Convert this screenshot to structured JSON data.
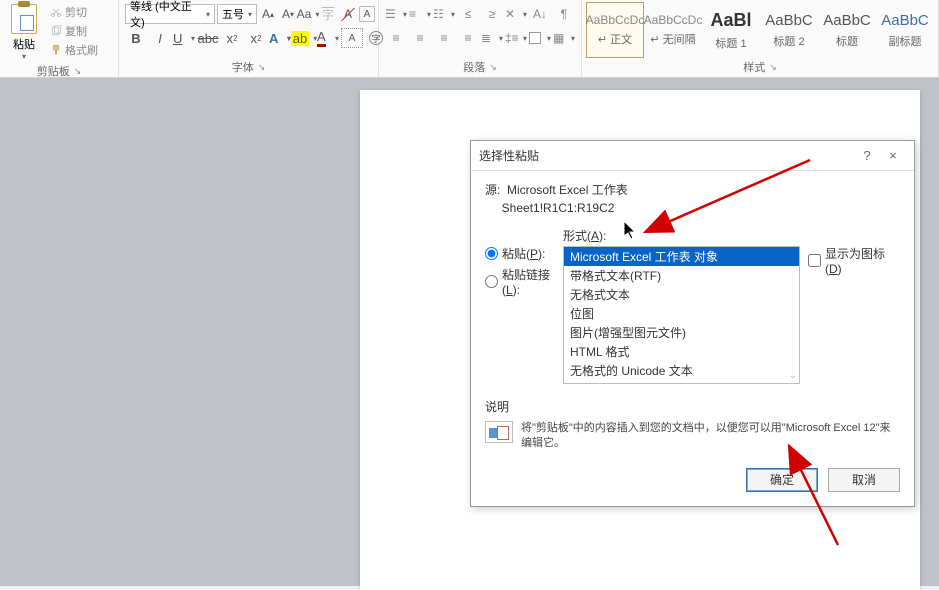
{
  "ribbon": {
    "clipboard": {
      "paste_label": "粘贴",
      "cut": "剪切",
      "copy": "复制",
      "format_painter": "格式刷",
      "group_label": "剪贴板"
    },
    "font": {
      "font_name": "等线 (中文正文)",
      "font_size": "五号",
      "group_label": "字体"
    },
    "paragraph": {
      "group_label": "段落"
    },
    "styles": {
      "group_label": "样式",
      "items": [
        {
          "preview": "AaBbCcDc",
          "name": "↵ 正文",
          "class": "style-preview"
        },
        {
          "preview": "AaBbCcDc",
          "name": "↵ 无间隔",
          "class": "style-preview"
        },
        {
          "preview": "AaBl",
          "name": "标题 1",
          "class": "style-preview big"
        },
        {
          "preview": "AaBbC",
          "name": "标题 2",
          "class": "style-preview mid"
        },
        {
          "preview": "AaBbC",
          "name": "标题",
          "class": "style-preview mid"
        },
        {
          "preview": "AaBbC",
          "name": "副标题",
          "class": "style-preview mid blue"
        }
      ]
    }
  },
  "dialog": {
    "title": "选择性粘贴",
    "help": "?",
    "close": "×",
    "source_label": "源:",
    "source_app": "Microsoft Excel 工作表",
    "source_range": "Sheet1!R1C1:R19C2",
    "format_label_pre": "形式(",
    "format_label_hk": "A",
    "format_label_post": "):",
    "paste_radio_pre": "粘贴(",
    "paste_radio_hk": "P",
    "paste_radio_post": "):",
    "pastelink_radio_pre": "粘贴链接(",
    "pastelink_radio_hk": "L",
    "pastelink_radio_post": "):",
    "formats": [
      "Microsoft Excel 工作表 对象",
      "带格式文本(RTF)",
      "无格式文本",
      "位图",
      "图片(增强型图元文件)",
      "HTML 格式",
      "无格式的 Unicode 文本"
    ],
    "show_as_icon_pre": "显示为图标(",
    "show_as_icon_hk": "D",
    "show_as_icon_post": ")",
    "desc_label": "说明",
    "desc_text": "将\"剪贴板\"中的内容插入到您的文档中，以便您可以用\"Microsoft Excel 12\"来编辑它。",
    "ok": "确定",
    "cancel": "取消"
  }
}
